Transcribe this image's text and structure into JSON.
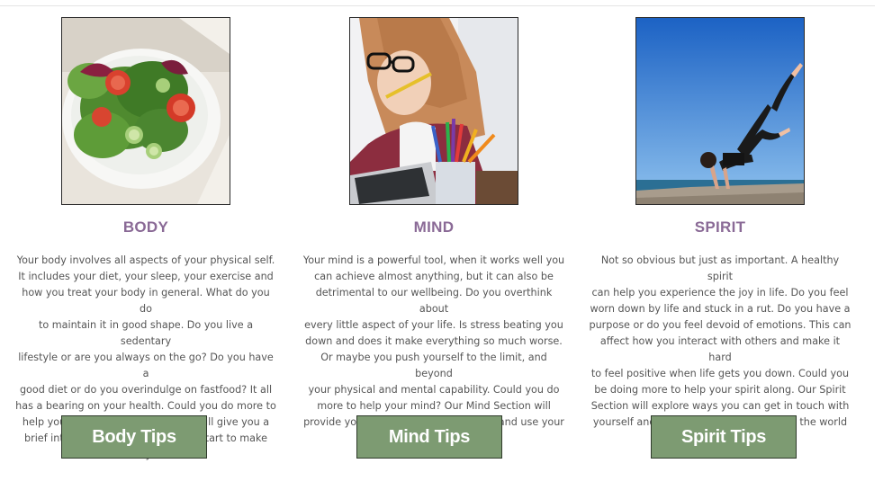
{
  "sections": [
    {
      "key": "body",
      "heading": "BODY",
      "image_alt": "bowl of salad with tomatoes and cucumber",
      "paragraph": "Your body involves all aspects of your physical self.\nIt includes your diet, your sleep, your exercise and\nhow you treat your body in general. What do you do\nto maintain it in good shape. Do you live a sedentary\nlifestyle or are you always on the go? Do you have a\ngood diet or do you overindulge on fastfood? It all\nhas a bearing on your health. Could you do more to\nhelp your body? Our body Section will give you a\nbrief introduction to ways you can start to make\nbetter lifestyle choices.",
      "button_label": "Body Tips"
    },
    {
      "key": "mind",
      "heading": "MIND",
      "image_alt": "woman with glasses thinking at desk with pencils",
      "paragraph": "Your mind is a powerful tool, when it works well you\ncan achieve almost anything, but it can also be\ndetrimental to our wellbeing. Do you overthink about\nevery little aspect of your life. Is stress beating you\ndown and does it make everything so much worse.\nOr maybe you push yourself to the limit, and beyond\nyour physical and mental capability. Could you do\nmore to help your mind? Our Mind Section will\nprovide you with ways to quiten down and use your\nmind more affectively.",
      "button_label": "Mind Tips"
    },
    {
      "key": "spirit",
      "heading": "SPIRIT",
      "image_alt": "woman doing yoga pose on beach under blue sky",
      "paragraph": "Not so obvious but just as important. A healthy spirit\ncan help you experience the joy in life. Do you feel\nworn down by life and stuck in a rut. Do you have a\npurpose or do you feel devoid of emotions. This can\naffect how you interact with others and make it hard\nto feel positive when life gets you down. Could you\nbe doing more to help your spirit along. Our Spirit\nSection will explore ways you can get in touch with\nyourself and build your relationship with the world\naround you.",
      "button_label": "Spirit Tips"
    }
  ],
  "colors": {
    "heading": "#8a6a96",
    "button_bg": "#7d9b72",
    "button_text": "#ffffff",
    "paragraph": "#555555"
  }
}
